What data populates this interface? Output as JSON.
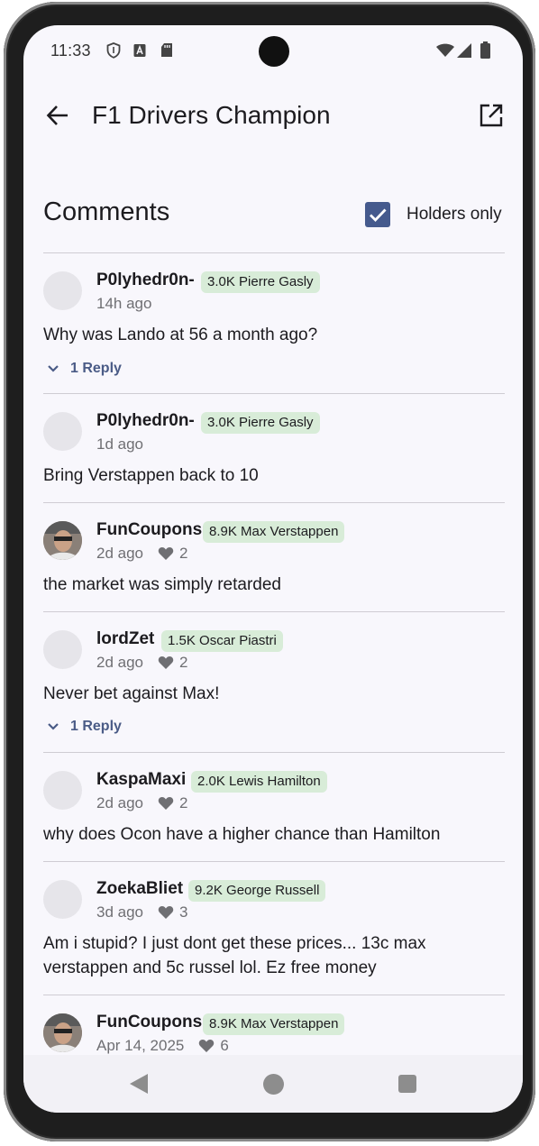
{
  "status_bar": {
    "time": "11:33"
  },
  "app_bar": {
    "title": "F1 Drivers Champion"
  },
  "comments_section": {
    "title": "Comments",
    "filter_label": "Holders only",
    "filter_checked": true
  },
  "comments": [
    {
      "user": "P0lyhedr0n-",
      "badge": "3.0K Pierre Gasly",
      "time": "14h ago",
      "likes": "",
      "text": "Why was Lando at 56 a month ago?",
      "reply_label": "1 Reply"
    },
    {
      "user": "P0lyhedr0n-",
      "badge": "3.0K Pierre Gasly",
      "time": "1d ago",
      "likes": "",
      "text": "Bring Verstappen back to 10",
      "reply_label": ""
    },
    {
      "user": "FunCoupons",
      "badge": "8.9K Max Verstappen",
      "time": "2d ago",
      "likes": "2",
      "text": "the market was simply retarded",
      "reply_label": ""
    },
    {
      "user": "lordZet",
      "badge": "1.5K Oscar Piastri",
      "time": "2d ago",
      "likes": "2",
      "text": "Never bet against Max!",
      "reply_label": "1 Reply"
    },
    {
      "user": "KaspaMaxi",
      "badge": "2.0K Lewis Hamilton",
      "time": "2d ago",
      "likes": "2",
      "text": "why does Ocon have a higher chance than Hamilton",
      "reply_label": ""
    },
    {
      "user": "ZoekaBliet",
      "badge": "9.2K George Russell",
      "time": "3d ago",
      "likes": "3",
      "text_line1": "Am i stupid? I just dont get these prices... 13c max",
      "text_line2": "verstappen and 5c russel lol. Ez free money",
      "reply_label": ""
    },
    {
      "user": "FunCoupons",
      "badge": "8.9K Max Verstappen",
      "time": "Apr 14, 2025",
      "likes": "6",
      "text": "",
      "reply_label": ""
    }
  ],
  "colors": {
    "accent": "#455a8d",
    "badge_bg": "#d8ecd8",
    "background": "#f8f7fc"
  }
}
